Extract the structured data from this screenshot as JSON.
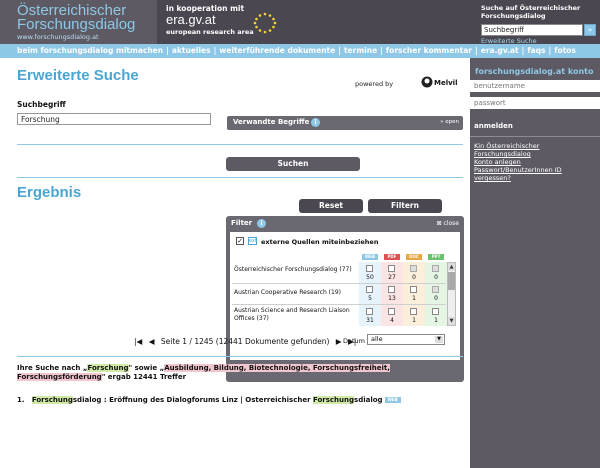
{
  "header": {
    "logo_line1": "Österreichischer",
    "logo_line2": "Forschungsdialog",
    "logo_url": "www.forschungsdialog.at",
    "coop_line1": "in kooperation mit",
    "coop_line2": "era.gv.at",
    "coop_line3": "european research area",
    "search_title": "Suche auf Österreichischer Forschungsdialog",
    "search_value": "Suchbegriff",
    "search_go": "»",
    "advanced_link": "Erweiterte Suche"
  },
  "nav": {
    "items": [
      "beim forschungsdialog mitmachen",
      "aktuelles",
      "weiterführende dokumente",
      "termine",
      "forscher kommentar",
      "era.gv.at",
      "faqs",
      "fotos"
    ],
    "separator": "|"
  },
  "main": {
    "title": "Erweiterte Suche",
    "powered_by": "powered by",
    "melvil": "Melvil",
    "suchbegriff_label": "Suchbegriff",
    "suchbegriff_value": "Forschung",
    "verwandte_label": "Verwandte Begriffe",
    "verwandte_open": "» open",
    "search_button": "Suchen",
    "ergebnis_title": "Ergebnis"
  },
  "filter": {
    "title": "Filter",
    "close": "close",
    "extern_label": "externe Quellen miteinbeziehen",
    "formats": [
      {
        "label": "WEB",
        "color": "#8ec8e6"
      },
      {
        "label": "PDF",
        "color": "#e05050"
      },
      {
        "label": "DOC",
        "color": "#e6a640"
      },
      {
        "label": "PPT",
        "color": "#6cc26c"
      }
    ],
    "sources": [
      {
        "name": "Österreichischer Forschungsdialog (77)",
        "counts": [
          "50",
          "27",
          "0",
          "0"
        ]
      },
      {
        "name": "Austrian Cooperative Research (19)",
        "counts": [
          "5",
          "13",
          "1",
          "0"
        ]
      },
      {
        "name": "Austrian Science and Research Liaison Offices (37)",
        "counts": [
          "31",
          "4",
          "1",
          "1"
        ]
      }
    ],
    "datum_label": "Datum",
    "datum_value": "alle",
    "reset": "Reset",
    "filtern": "Filtern"
  },
  "pager": {
    "first": "|◀",
    "prev": "◀",
    "text": "Seite 1 / 1245 (12441 Dokumente gefunden)",
    "next": "▶",
    "last": "▶|"
  },
  "summary": {
    "p1": "Ihre Suche nach „",
    "term": "Forschung",
    "p2": "\" sowie „",
    "topics": "Ausbildung, Bildung, Biotechnologie, Forschungsfreiheit, Forschungsförderung",
    "p3": "\" ergab 12441 Treffer"
  },
  "result1": {
    "num": "1.",
    "hl1": "Forschung",
    "t1": "sdialog : Eröffnung des Dialogforums Linz | Österreichischer ",
    "hl2": "Forschung",
    "t2": "sdialog",
    "badge": "WEB"
  },
  "sidebar": {
    "title": "forschungsdialog.at konto",
    "username_placeholder": "benutzername",
    "password_placeholder": "passwort",
    "anmelden": "anmelden",
    "links": [
      "Kin Österreichischer Forschungsdialog",
      "Konto anlegen",
      "Passwort/BenutzerInnen ID vergessen?"
    ]
  },
  "colors": {
    "accent": "#8ec8e6",
    "header_bg": "#4a4750",
    "sidebar_bg": "#5d5a64"
  }
}
